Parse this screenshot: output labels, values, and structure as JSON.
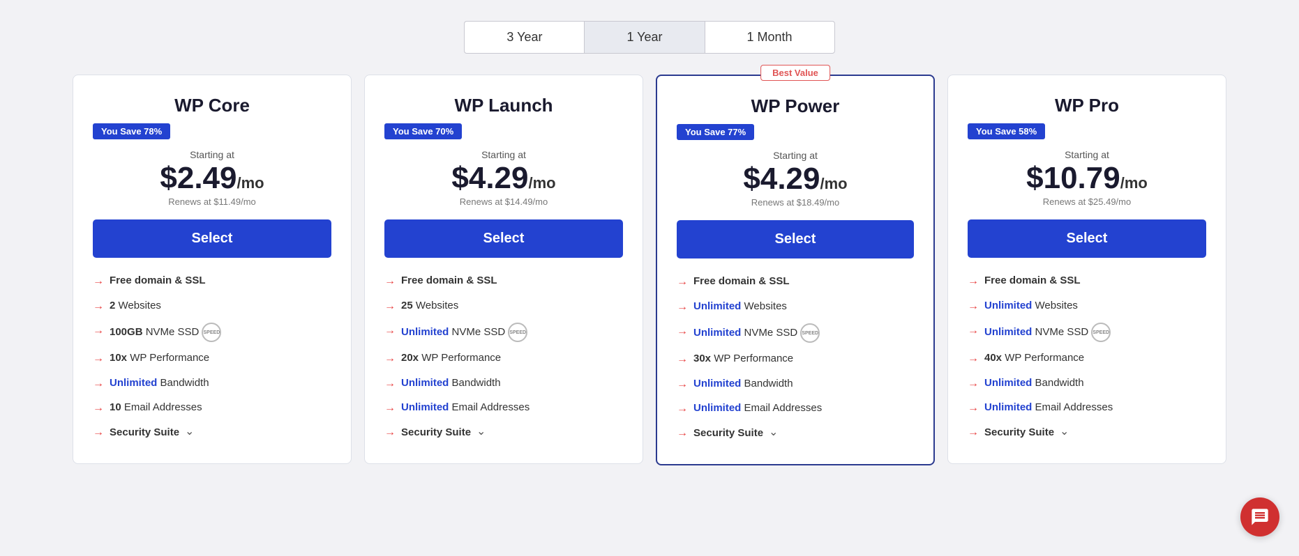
{
  "period_toggle": {
    "options": [
      "3 Year",
      "1 Year",
      "1 Month"
    ],
    "active": "1 Year"
  },
  "plans": [
    {
      "id": "wp-core",
      "name": "WP Core",
      "featured": false,
      "best_value": false,
      "you_save": "You Save 78%",
      "starting_at_label": "Starting at",
      "price": "$2.49",
      "period": "/mo",
      "renews": "Renews at $11.49/mo",
      "select_label": "Select",
      "features": [
        {
          "bold": "Free domain & SSL",
          "highlight": false,
          "normal": ""
        },
        {
          "bold": "2",
          "highlight": false,
          "normal": " Websites"
        },
        {
          "bold": "100GB",
          "highlight": false,
          "normal": " NVMe SSD",
          "speed": true
        },
        {
          "bold": "10x",
          "highlight": false,
          "normal": " WP Performance"
        },
        {
          "bold": "Unlimited",
          "highlight": true,
          "normal": " Bandwidth"
        },
        {
          "bold": "10",
          "highlight": false,
          "normal": " Email Addresses"
        },
        {
          "bold": "Security Suite",
          "highlight": false,
          "normal": "",
          "chevron": true
        }
      ]
    },
    {
      "id": "wp-launch",
      "name": "WP Launch",
      "featured": false,
      "best_value": false,
      "you_save": "You Save 70%",
      "starting_at_label": "Starting at",
      "price": "$4.29",
      "period": "/mo",
      "renews": "Renews at $14.49/mo",
      "select_label": "Select",
      "features": [
        {
          "bold": "Free domain & SSL",
          "highlight": false,
          "normal": ""
        },
        {
          "bold": "25",
          "highlight": false,
          "normal": " Websites"
        },
        {
          "bold": "Unlimited",
          "highlight": true,
          "normal": " NVMe SSD",
          "speed": true
        },
        {
          "bold": "20x",
          "highlight": false,
          "normal": " WP Performance"
        },
        {
          "bold": "Unlimited",
          "highlight": true,
          "normal": " Bandwidth"
        },
        {
          "bold": "Unlimited",
          "highlight": true,
          "normal": " Email Addresses"
        },
        {
          "bold": "Security Suite",
          "highlight": false,
          "normal": "",
          "chevron": true
        }
      ]
    },
    {
      "id": "wp-power",
      "name": "WP Power",
      "featured": true,
      "best_value": true,
      "best_value_label": "Best Value",
      "you_save": "You Save 77%",
      "starting_at_label": "Starting at",
      "price": "$4.29",
      "period": "/mo",
      "renews": "Renews at $18.49/mo",
      "select_label": "Select",
      "features": [
        {
          "bold": "Free domain & SSL",
          "highlight": false,
          "normal": ""
        },
        {
          "bold": "Unlimited",
          "highlight": true,
          "normal": " Websites"
        },
        {
          "bold": "Unlimited",
          "highlight": true,
          "normal": " NVMe SSD",
          "speed": true
        },
        {
          "bold": "30x",
          "highlight": false,
          "normal": " WP Performance"
        },
        {
          "bold": "Unlimited",
          "highlight": true,
          "normal": " Bandwidth"
        },
        {
          "bold": "Unlimited",
          "highlight": true,
          "normal": " Email Addresses"
        },
        {
          "bold": "Security Suite",
          "highlight": false,
          "normal": "",
          "chevron": true
        }
      ]
    },
    {
      "id": "wp-pro",
      "name": "WP Pro",
      "featured": false,
      "best_value": false,
      "you_save": "You Save 58%",
      "starting_at_label": "Starting at",
      "price": "$10.79",
      "period": "/mo",
      "renews": "Renews at $25.49/mo",
      "select_label": "Select",
      "features": [
        {
          "bold": "Free domain & SSL",
          "highlight": false,
          "normal": ""
        },
        {
          "bold": "Unlimited",
          "highlight": true,
          "normal": " Websites"
        },
        {
          "bold": "Unlimited",
          "highlight": true,
          "normal": " NVMe SSD",
          "speed": true
        },
        {
          "bold": "40x",
          "highlight": false,
          "normal": " WP Performance"
        },
        {
          "bold": "Unlimited",
          "highlight": true,
          "normal": " Bandwidth"
        },
        {
          "bold": "Unlimited",
          "highlight": true,
          "normal": " Email Addresses"
        },
        {
          "bold": "Security Suite",
          "highlight": false,
          "normal": "",
          "chevron": true
        }
      ]
    }
  ],
  "chat_fab_title": "Open chat"
}
